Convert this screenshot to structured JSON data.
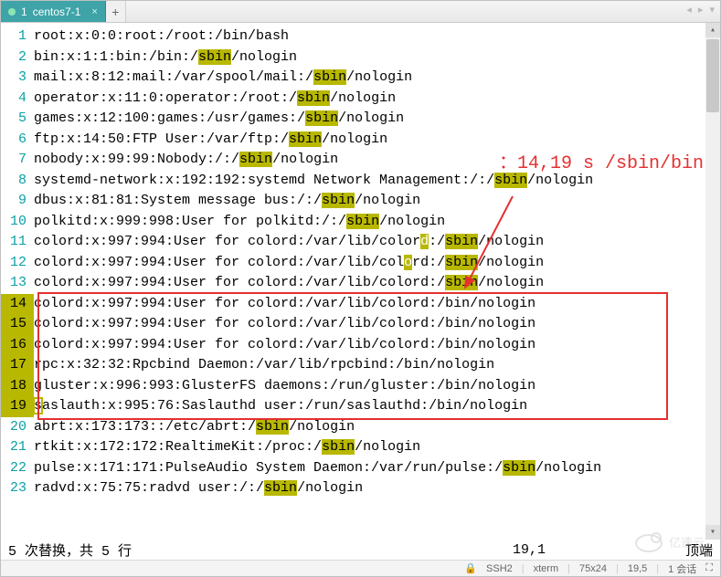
{
  "tab": {
    "index": "1",
    "title": "centos7-1",
    "close": "×",
    "add": "+",
    "nav": "◂ ▸ ▾"
  },
  "annotation": "：14,19 s /sbin/bin",
  "lines": [
    {
      "n": 1,
      "segs": [
        {
          "t": "root:x:0:0:root:/root:/bin/bash"
        }
      ]
    },
    {
      "n": 2,
      "segs": [
        {
          "t": "bin:x:1:1:bin:/bin:/"
        },
        {
          "t": "sbin",
          "h": 1
        },
        {
          "t": "/nologin"
        }
      ]
    },
    {
      "n": 3,
      "segs": [
        {
          "t": "mail:x:8:12:mail:/var/spool/mail:/"
        },
        {
          "t": "sbin",
          "h": 1
        },
        {
          "t": "/nologin"
        }
      ]
    },
    {
      "n": 4,
      "segs": [
        {
          "t": "operator:x:11:0:operator:/root:/"
        },
        {
          "t": "sbin",
          "h": 1
        },
        {
          "t": "/nologin"
        }
      ]
    },
    {
      "n": 5,
      "segs": [
        {
          "t": "games:x:12:100:games:/usr/games:/"
        },
        {
          "t": "sbin",
          "h": 1
        },
        {
          "t": "/nologin"
        }
      ]
    },
    {
      "n": 6,
      "segs": [
        {
          "t": "ftp:x:14:50:FTP User:/var/ftp:/"
        },
        {
          "t": "sbin",
          "h": 1
        },
        {
          "t": "/nologin"
        }
      ]
    },
    {
      "n": 7,
      "segs": [
        {
          "t": "nobody:x:99:99:Nobody:/:/"
        },
        {
          "t": "sbin",
          "h": 1
        },
        {
          "t": "/nologin"
        }
      ]
    },
    {
      "n": 8,
      "segs": [
        {
          "t": "systemd-network:x:192:192:systemd Network Management:/:/"
        },
        {
          "t": "sbin",
          "h": 1
        },
        {
          "t": "/nologin"
        }
      ]
    },
    {
      "n": 9,
      "segs": [
        {
          "t": "dbus:x:81:81:System message bus:/:/"
        },
        {
          "t": "sbin",
          "h": 1
        },
        {
          "t": "/nologin"
        }
      ]
    },
    {
      "n": 10,
      "segs": [
        {
          "t": "polkitd:x:999:998:User for polkitd:/:/"
        },
        {
          "t": "sbin",
          "h": 1
        },
        {
          "t": "/nologin"
        }
      ]
    },
    {
      "n": 11,
      "segs": [
        {
          "t": "colord:x:997:994:User for colord:/var/lib/color"
        },
        {
          "t": "d",
          "h": 2
        },
        {
          "t": ":/"
        },
        {
          "t": "sbin",
          "h": 1
        },
        {
          "t": "/nologin"
        }
      ]
    },
    {
      "n": 12,
      "segs": [
        {
          "t": "colord:x:997:994:User for colord:/var/lib/col"
        },
        {
          "t": "o",
          "h": 2
        },
        {
          "t": "rd:/"
        },
        {
          "t": "sbin",
          "h": 1
        },
        {
          "t": "/nologin"
        }
      ]
    },
    {
      "n": 13,
      "segs": [
        {
          "t": "colord:x:997:994:User for colord:/var/lib/colord:/"
        },
        {
          "t": "sbin",
          "h": 1
        },
        {
          "t": "/nologin"
        }
      ]
    },
    {
      "n": 14,
      "segs": [
        {
          "t": "colord:x:997:994:User for colord:/var/lib/colord:/bin/nologin"
        }
      ],
      "box": 1
    },
    {
      "n": 15,
      "segs": [
        {
          "t": "colord:x:997:994:User for colord:/var/lib/colord:/bin/nologin"
        }
      ],
      "box": 1
    },
    {
      "n": 16,
      "segs": [
        {
          "t": "colord:x:997:994:User for colord:/var/lib/colord:/bin/nologin"
        }
      ],
      "box": 1
    },
    {
      "n": 17,
      "segs": [
        {
          "t": "rpc:x:32:32:Rpcbind Daemon:/var/lib/rpcbind:/bin/nologin"
        }
      ],
      "box": 1
    },
    {
      "n": 18,
      "segs": [
        {
          "t": "gluster:x:996:993:GlusterFS daemons:/run/gluster:/bin/nologin"
        }
      ],
      "box": 1
    },
    {
      "n": 19,
      "segs": [
        {
          "t": "s",
          "h": 3
        },
        {
          "t": "aslauth:x:995:76:Saslauthd user:/run/saslauthd:/bin/nologin"
        }
      ],
      "box": 1
    },
    {
      "n": 20,
      "segs": [
        {
          "t": "abrt:x:173:173::/etc/abrt:/"
        },
        {
          "t": "sbin",
          "h": 1
        },
        {
          "t": "/nologin"
        }
      ]
    },
    {
      "n": 21,
      "segs": [
        {
          "t": "rtkit:x:172:172:RealtimeKit:/proc:/"
        },
        {
          "t": "sbin",
          "h": 1
        },
        {
          "t": "/nologin"
        }
      ]
    },
    {
      "n": 22,
      "segs": [
        {
          "t": "pulse:x:171:171:PulseAudio System Daemon:/var/run/pulse:/"
        },
        {
          "t": "sbin",
          "h": 1
        },
        {
          "t": "/nologin"
        }
      ]
    },
    {
      "n": 23,
      "segs": [
        {
          "t": "radvd:x:75:75:radvd user:/:/"
        },
        {
          "t": "sbin",
          "h": 1
        },
        {
          "t": "/nologin"
        }
      ]
    }
  ],
  "status": {
    "msg": "5 次替换，共 5 行",
    "pos": "19,1",
    "scroll": "顶端"
  },
  "bottom": {
    "conn": "SSH2",
    "term": "xterm",
    "size": "75x24",
    "cur": "19,5",
    "sess": "1 会话",
    "brand": "亿速云"
  }
}
